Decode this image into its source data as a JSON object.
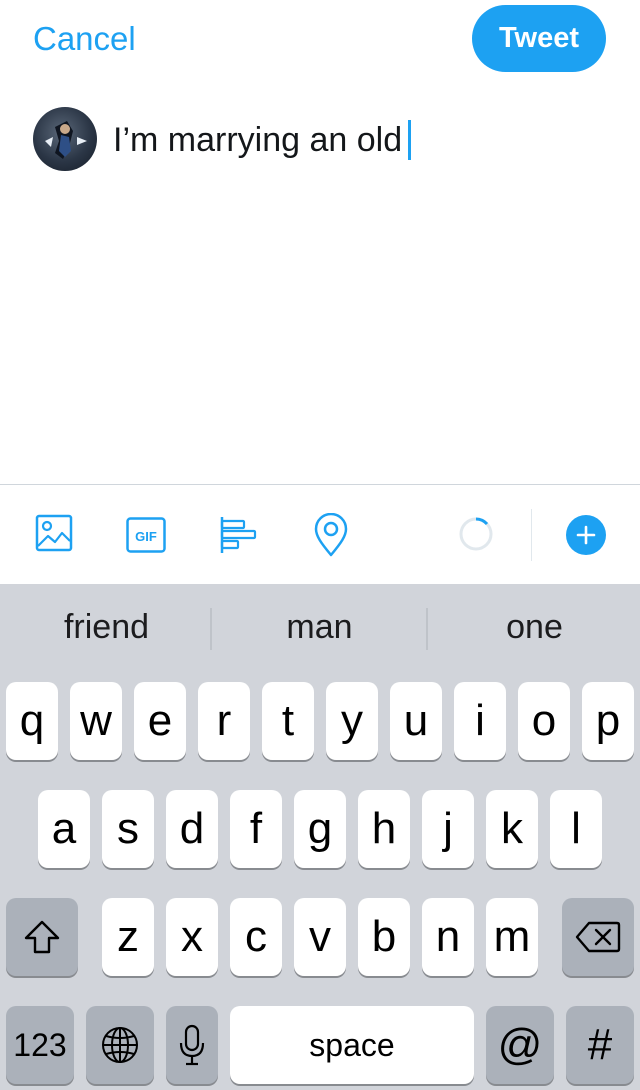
{
  "header": {
    "cancel_label": "Cancel",
    "tweet_label": "Tweet"
  },
  "compose": {
    "text": "I’m marrying an old"
  },
  "toolbar": {
    "icons": [
      "image-icon",
      "gif-icon",
      "poll-icon",
      "location-icon",
      "character-count-ring-icon",
      "add-tweet-icon"
    ],
    "gif_label": "GIF",
    "accent_color": "#1da1f2"
  },
  "keyboard": {
    "suggestions": [
      "friend",
      "man",
      "one"
    ],
    "row1": [
      "q",
      "w",
      "e",
      "r",
      "t",
      "y",
      "u",
      "i",
      "o",
      "p"
    ],
    "row2": [
      "a",
      "s",
      "d",
      "f",
      "g",
      "h",
      "j",
      "k",
      "l"
    ],
    "row3": [
      "z",
      "x",
      "c",
      "v",
      "b",
      "n",
      "m"
    ],
    "numbers_label": "123",
    "space_label": "space",
    "at_label": "@",
    "hash_label": "#"
  }
}
